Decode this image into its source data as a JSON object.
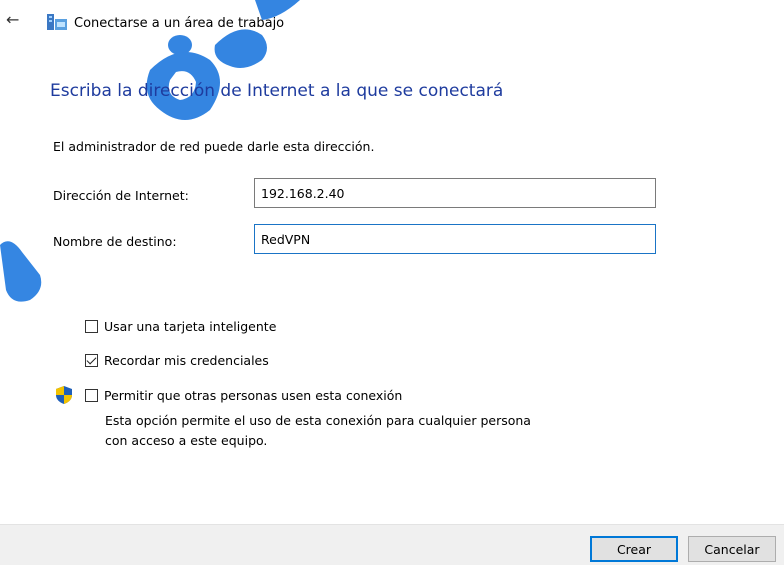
{
  "window": {
    "title": "Conectarse a un área de trabajo",
    "back_icon": "arrow-left-icon",
    "app_icon": "network-workplace-icon"
  },
  "heading": "Escriba la dirección de Internet a la que se conectará",
  "info_text": "El administrador de red puede darle esta dirección.",
  "fields": {
    "internet_address_label": "Dirección de Internet:",
    "internet_address_value": "192.168.2.40",
    "destination_name_label": "Nombre de destino:",
    "destination_name_value": "RedVPN"
  },
  "options": [
    {
      "label": "Usar una tarjeta inteligente",
      "checked": false
    },
    {
      "label": "Recordar mis credenciales",
      "checked": true
    },
    {
      "label": "Permitir que otras personas usen esta conexión",
      "checked": false
    }
  ],
  "shared_description": "Esta opción permite el uso de esta conexión para cualquier persona con acceso a este equipo.",
  "buttons": {
    "create": "Crear",
    "cancel": "Cancelar"
  },
  "colors": {
    "heading": "#1e3b9e",
    "accent": "#0078d7",
    "watermark": "#2a7fe0"
  }
}
